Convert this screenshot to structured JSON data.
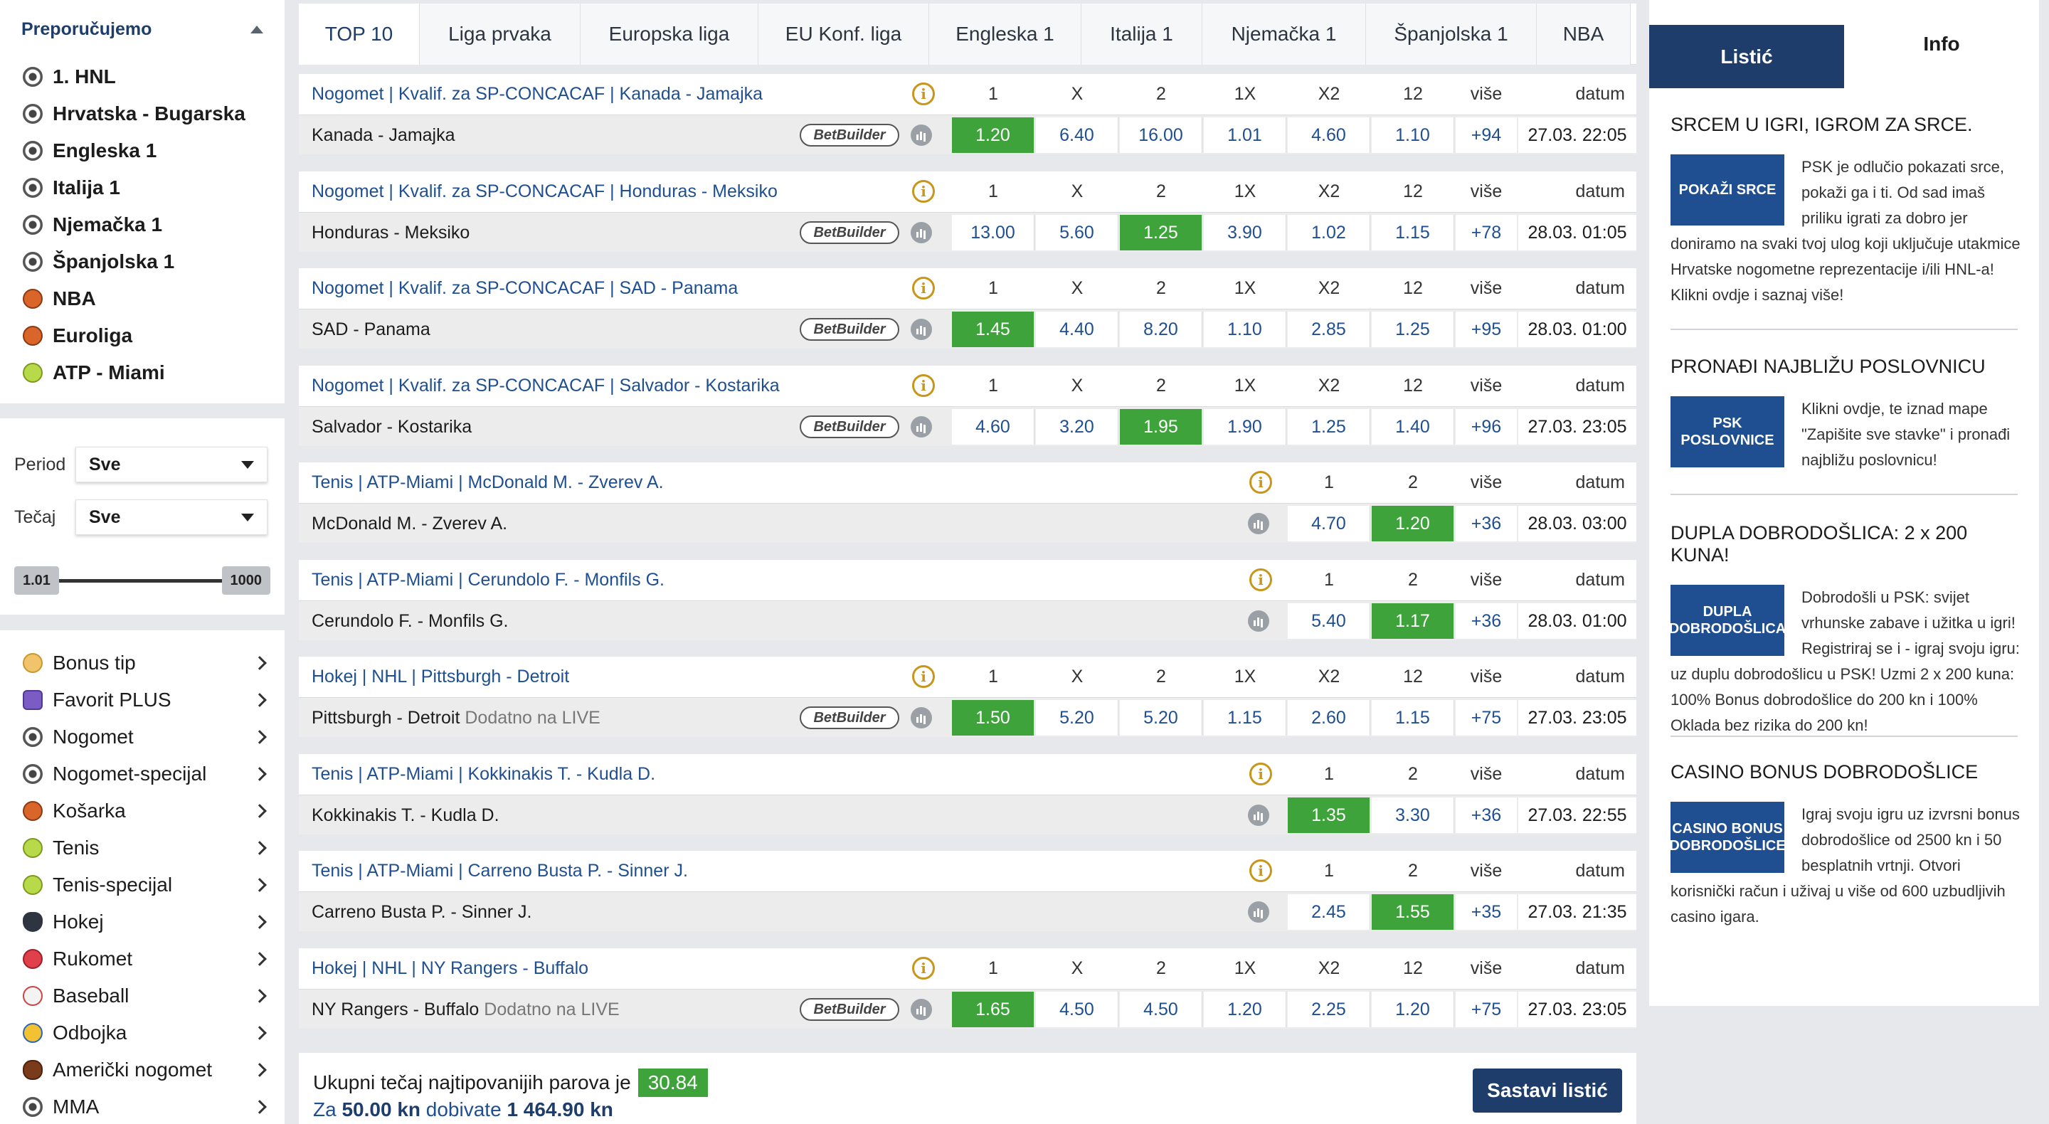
{
  "recommended": {
    "title": "Preporučujemo",
    "items": [
      {
        "label": "1. HNL",
        "icon": "football-icon"
      },
      {
        "label": "Hrvatska - Bugarska",
        "icon": "football-icon"
      },
      {
        "label": "Engleska 1",
        "icon": "football-icon"
      },
      {
        "label": "Italija 1",
        "icon": "football-icon"
      },
      {
        "label": "Njemačka 1",
        "icon": "football-icon"
      },
      {
        "label": "Španjolska 1",
        "icon": "football-icon"
      },
      {
        "label": "NBA",
        "icon": "basketball-icon"
      },
      {
        "label": "Euroliga",
        "icon": "basketball-icon"
      },
      {
        "label": "ATP - Miami",
        "icon": "tennis-ball-icon"
      }
    ]
  },
  "filters": {
    "period_label": "Period",
    "period_value": "Sve",
    "odds_label": "Tečaj",
    "odds_value": "Sve",
    "slider_min": "1.01",
    "slider_max": "1000"
  },
  "sports": [
    {
      "label": "Bonus tip",
      "icon": "star-icon"
    },
    {
      "label": "Favorit PLUS",
      "icon": "plus-icon"
    },
    {
      "label": "Nogomet",
      "icon": "football-icon"
    },
    {
      "label": "Nogomet-specijal",
      "icon": "football-icon"
    },
    {
      "label": "Košarka",
      "icon": "basketball-icon"
    },
    {
      "label": "Tenis",
      "icon": "tennis-ball-icon"
    },
    {
      "label": "Tenis-specijal",
      "icon": "tennis-ball-icon"
    },
    {
      "label": "Hokej",
      "icon": "hockey-puck-icon"
    },
    {
      "label": "Rukomet",
      "icon": "handball-icon"
    },
    {
      "label": "Baseball",
      "icon": "baseball-icon"
    },
    {
      "label": "Odbojka",
      "icon": "volleyball-icon"
    },
    {
      "label": "Američki nogomet",
      "icon": "american-football-icon"
    },
    {
      "label": "MMA",
      "icon": "mma-icon"
    }
  ],
  "tabs": [
    "TOP 10",
    "Liga prvaka",
    "Europska liga",
    "EU Konf. liga",
    "Engleska 1",
    "Italija 1",
    "Njemačka 1",
    "Španjolska 1",
    "NBA"
  ],
  "headers": {
    "three_way": [
      "1",
      "X",
      "2",
      "1X",
      "X2",
      "12"
    ],
    "two_way": [
      "1",
      "2"
    ],
    "more": "više",
    "date": "datum"
  },
  "events": [
    {
      "type": "three",
      "title": "Nogomet | Kvalif. za SP-CONCACAF | Kanada - Jamajka",
      "name": "Kanada - Jamajka",
      "live": "",
      "betbuilder": "BetBuilder",
      "odds": [
        "1.20",
        "6.40",
        "16.00",
        "1.01",
        "4.60",
        "1.10"
      ],
      "hl": 0,
      "more": "+94",
      "date": "27.03. 22:05"
    },
    {
      "type": "three",
      "title": "Nogomet | Kvalif. za SP-CONCACAF | Honduras - Meksiko",
      "name": "Honduras - Meksiko",
      "live": "",
      "betbuilder": "BetBuilder",
      "odds": [
        "13.00",
        "5.60",
        "1.25",
        "3.90",
        "1.02",
        "1.15"
      ],
      "hl": 2,
      "more": "+78",
      "date": "28.03. 01:05"
    },
    {
      "type": "three",
      "title": "Nogomet | Kvalif. za SP-CONCACAF | SAD - Panama",
      "name": "SAD - Panama",
      "live": "",
      "betbuilder": "BetBuilder",
      "odds": [
        "1.45",
        "4.40",
        "8.20",
        "1.10",
        "2.85",
        "1.25"
      ],
      "hl": 0,
      "more": "+95",
      "date": "28.03. 01:00"
    },
    {
      "type": "three",
      "title": "Nogomet | Kvalif. za SP-CONCACAF | Salvador - Kostarika",
      "name": "Salvador - Kostarika",
      "live": "",
      "betbuilder": "BetBuilder",
      "odds": [
        "4.60",
        "3.20",
        "1.95",
        "1.90",
        "1.25",
        "1.40"
      ],
      "hl": 2,
      "more": "+96",
      "date": "27.03. 23:05"
    },
    {
      "type": "two",
      "title": "Tenis | ATP-Miami | McDonald M. - Zverev A.",
      "name": "McDonald M. - Zverev A.",
      "live": "",
      "betbuilder": "",
      "odds": [
        "4.70",
        "1.20"
      ],
      "hl": 1,
      "more": "+36",
      "date": "28.03. 03:00"
    },
    {
      "type": "two",
      "title": "Tenis | ATP-Miami | Cerundolo F. - Monfils G.",
      "name": "Cerundolo F. - Monfils G.",
      "live": "",
      "betbuilder": "",
      "odds": [
        "5.40",
        "1.17"
      ],
      "hl": 1,
      "more": "+36",
      "date": "28.03. 01:00"
    },
    {
      "type": "three",
      "title": "Hokej | NHL | Pittsburgh - Detroit",
      "name": "Pittsburgh - Detroit",
      "live": "Dodatno na LIVE",
      "betbuilder": "BetBuilder",
      "odds": [
        "1.50",
        "5.20",
        "5.20",
        "1.15",
        "2.60",
        "1.15"
      ],
      "hl": 0,
      "more": "+75",
      "date": "27.03. 23:05"
    },
    {
      "type": "two",
      "title": "Tenis | ATP-Miami | Kokkinakis T. - Kudla D.",
      "name": "Kokkinakis T. - Kudla D.",
      "live": "",
      "betbuilder": "",
      "odds": [
        "1.35",
        "3.30"
      ],
      "hl": 0,
      "more": "+36",
      "date": "27.03. 22:55"
    },
    {
      "type": "two",
      "title": "Tenis | ATP-Miami | Carreno Busta P. - Sinner J.",
      "name": "Carreno Busta P. - Sinner J.",
      "live": "",
      "betbuilder": "",
      "odds": [
        "2.45",
        "1.55"
      ],
      "hl": 1,
      "more": "+35",
      "date": "27.03. 21:35"
    },
    {
      "type": "three",
      "title": "Hokej | NHL | NY Rangers - Buffalo",
      "name": "NY Rangers - Buffalo",
      "live": "Dodatno na LIVE",
      "betbuilder": "BetBuilder",
      "odds": [
        "1.65",
        "4.50",
        "4.50",
        "1.20",
        "2.25",
        "1.20"
      ],
      "hl": 0,
      "more": "+75",
      "date": "27.03. 23:05"
    }
  ],
  "footer": {
    "total_text": "Ukupni tečaj najtipovanijih parova je",
    "total_value": "30.84",
    "win_prefix": "Za",
    "stake": "50.00 kn",
    "win_middle": "dobivate",
    "win_amount": "1 464.90 kn",
    "build_button": "Sastavi listić"
  },
  "right_panel": {
    "tab_slip": "Listić",
    "tab_info": "Info",
    "promos": [
      {
        "title": "SRCEM U IGRI, IGROM ZA SRCE.",
        "img": "POKAŽI SRCE",
        "text": "PSK je odlučio pokazati srce, pokaži ga i ti. Od sad imaš priliku igrati za dobro jer doniramo na svaki tvoj ulog koji uključuje utakmice Hrvatske nogometne reprezentacije i/ili  HNL-a!  Klikni ovdje i saznaj više!"
      },
      {
        "title": "PRONAĐI NAJBLIŽU POSLOVNICU",
        "img": "PSK POSLOVNICE",
        "text": "Klikni ovdje, te iznad mape \"Zapišite sve stavke\" i pronađi najbližu poslovnicu!"
      },
      {
        "title": "DUPLA DOBRODOŠLICA: 2 x 200 KUNA!",
        "img": "DUPLA DOBRODOŠLICA",
        "text": "Dobrodošli u PSK: svijet vrhunske zabave i užitka u igri! Registriraj se i - igraj svoju igru: uz duplu dobrodošlicu u PSK! Uzmi 2 x 200 kuna: 100% Bonus dobrodošlice do 200 kn i 100% Oklada bez rizika do 200 kn!"
      },
      {
        "title": "CASINO BONUS DOBRODOŠLICE",
        "img": "CASINO BONUS DOBRODOŠLICE",
        "text": "Igraj svoju igru uz izvrsni bonus dobrodošlice od 2500 kn i 50 besplatnih vrtnji. Otvori korisnički račun i uživaj u više od 600 uzbudljivih casino igara."
      }
    ]
  },
  "colors": {
    "brand_navy": "#1f3d6b",
    "link_blue": "#1f4f91",
    "highlight_green": "#3ea33a",
    "info_gold": "#c8961a"
  }
}
